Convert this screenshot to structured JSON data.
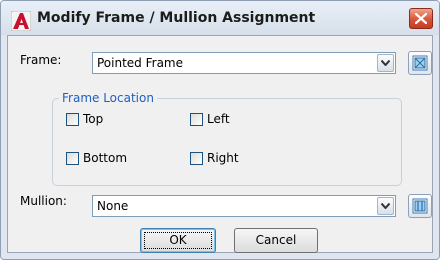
{
  "window": {
    "title": "Modify Frame / Mullion Assignment",
    "icon": "autocad-a-icon",
    "close_icon": "close-x-icon"
  },
  "frame": {
    "label": "Frame:",
    "selected": "Pointed Frame",
    "edit_icon": "frame-style-icon"
  },
  "frame_location": {
    "legend": "Frame Location",
    "checkboxes": [
      {
        "label": "Top",
        "checked": false
      },
      {
        "label": "Left",
        "checked": false
      },
      {
        "label": "Bottom",
        "checked": false
      },
      {
        "label": "Right",
        "checked": false
      }
    ]
  },
  "mullion": {
    "label": "Mullion:",
    "selected": "None",
    "edit_icon": "mullion-style-icon"
  },
  "buttons": {
    "ok": "OK",
    "cancel": "Cancel"
  },
  "colors": {
    "legend": "#1f5fc2",
    "close": "#d9543a",
    "app_icon": "#c8102e"
  }
}
